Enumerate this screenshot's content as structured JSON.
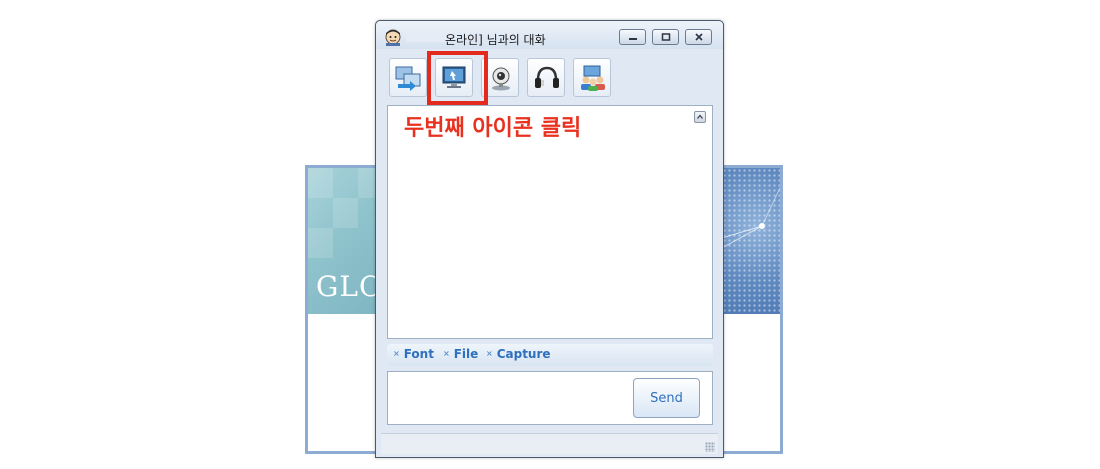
{
  "window": {
    "title": "온라인] 님과의 대화",
    "controls": {
      "minimize": "minimize",
      "maximize": "maximize",
      "close": "close"
    }
  },
  "toolbar": {
    "items": [
      {
        "icon": "file-transfer-icon"
      },
      {
        "icon": "monitor-icon"
      },
      {
        "icon": "webcam-icon"
      },
      {
        "icon": "headset-icon"
      },
      {
        "icon": "group-users-icon"
      }
    ]
  },
  "annotation": {
    "text": "두번째 아이콘 클릭",
    "color": "#e8321f",
    "highlight_color": "#e32b1d"
  },
  "options": {
    "font": "Font",
    "file": "File",
    "capture": "Capture"
  },
  "input": {
    "send_label": "Send"
  },
  "background": {
    "logo_text": "GLO",
    "accent": "#8eabd3"
  }
}
